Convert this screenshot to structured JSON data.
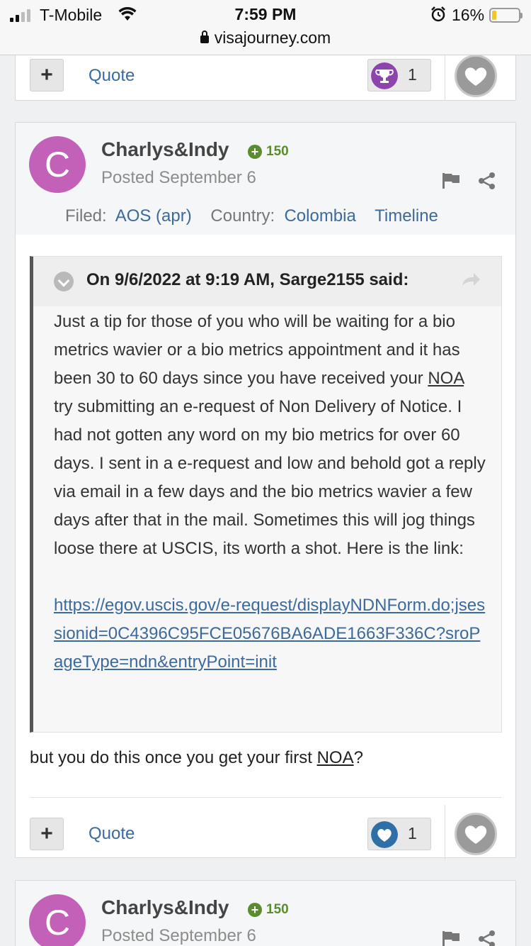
{
  "status_bar": {
    "carrier": "T-Mobile",
    "time": "7:59 PM",
    "battery_percent": "16%",
    "battery_level": 0.16,
    "url": "visajourney.com"
  },
  "top_actions": {
    "plus_label": "+",
    "quote_label": "Quote",
    "reaction_count": "1",
    "reaction_icon": "trophy-icon"
  },
  "post": {
    "avatar_letter": "C",
    "author": "Charlys&Indy",
    "reputation": "150",
    "posted": "Posted September 6",
    "filed_label": "Filed:",
    "filed_value": "AOS (apr)",
    "country_label": "Country:",
    "country_value": "Colombia",
    "timeline_label": "Timeline",
    "quote": {
      "citation": "On 9/6/2022 at 9:19 AM, Sarge2155 said:",
      "text_part1": "Just a tip for those of you who will be waiting for a bio metrics wavier or a bio metrics appointment and it has been 30 to 60 days since you have received your ",
      "abbr": "NOA",
      "text_part2": " try submitting an e-request of Non Delivery of Notice. I had not gotten any word on my bio metrics for over 60 days. I sent in a e-request and low and behold got a reply via email in a few days and the bio metrics wavier a few days after that in the mail. Sometimes this will jog things loose there at USCIS, its worth a shot. Here is the link:",
      "link": "https://egov.uscis.gov/e-request/displayNDNForm.do;jsessionid=0C4396C95FCE05676BA6ADE1663F336C?sroPageType=ndn&entryPoint=init"
    },
    "reply_part1": "but you do this once you get your first ",
    "reply_abbr": "NOA",
    "reply_part2": "?",
    "actions": {
      "plus_label": "+",
      "quote_label": "Quote",
      "reaction_count": "1",
      "reaction_icon": "like-heart-icon"
    }
  },
  "next_post": {
    "avatar_letter": "C",
    "author": "Charlys&Indy",
    "reputation": "150",
    "posted": "Posted September 6"
  },
  "colors": {
    "avatar": "#c361b8",
    "link": "#3c6a9e",
    "reputation": "#5c8c2f",
    "trophy_badge": "#8e44ad",
    "like_badge": "#2f6fa8"
  }
}
